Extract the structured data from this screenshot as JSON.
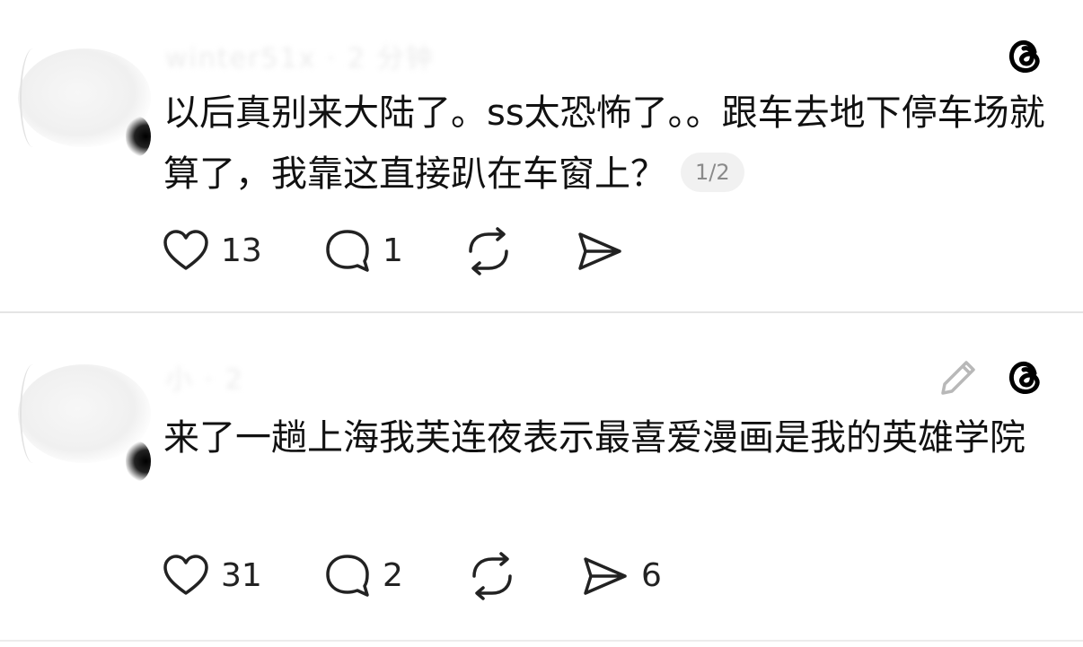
{
  "posts": [
    {
      "username": "winter51x  · 2 分钟",
      "content": "以后真别来大陆了。ss太恐怖了。。跟车去地下停车场就算了，我靠这直接趴在车窗上？",
      "page_indicator": "1/2",
      "likes": "13",
      "replies": "1",
      "reposts": "",
      "shares": "",
      "icons": [
        "heart-icon",
        "comment-icon",
        "repost-icon",
        "share-icon",
        "threads-logo-icon"
      ]
    },
    {
      "username": "小 · 2",
      "content": "来了一趟上海我芙连夜表示最喜爱漫画是我的英雄学院",
      "likes": "31",
      "replies": "2",
      "reposts": "",
      "shares": "6",
      "icons": [
        "heart-icon",
        "comment-icon",
        "repost-icon",
        "share-icon",
        "edit-icon",
        "threads-logo-icon"
      ]
    }
  ]
}
